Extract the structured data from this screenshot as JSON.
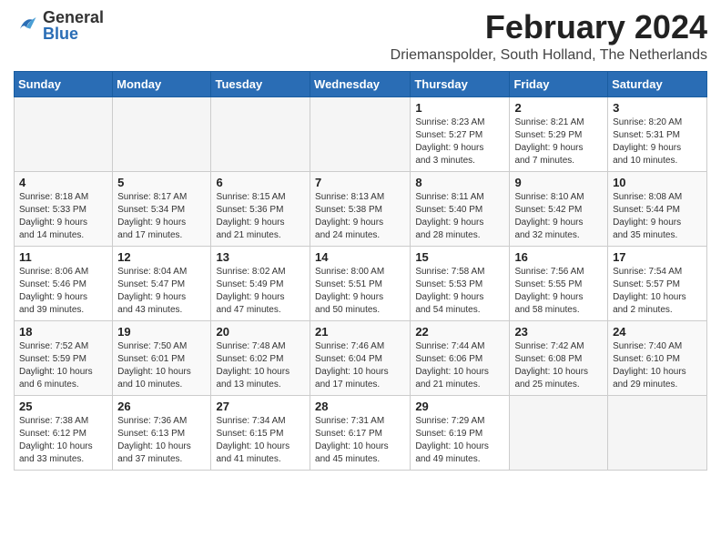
{
  "logo": {
    "general": "General",
    "blue": "Blue"
  },
  "title": "February 2024",
  "location": "Driemanspolder, South Holland, The Netherlands",
  "weekdays": [
    "Sunday",
    "Monday",
    "Tuesday",
    "Wednesday",
    "Thursday",
    "Friday",
    "Saturday"
  ],
  "weeks": [
    [
      {
        "day": "",
        "info": ""
      },
      {
        "day": "",
        "info": ""
      },
      {
        "day": "",
        "info": ""
      },
      {
        "day": "",
        "info": ""
      },
      {
        "day": "1",
        "info": "Sunrise: 8:23 AM\nSunset: 5:27 PM\nDaylight: 9 hours\nand 3 minutes."
      },
      {
        "day": "2",
        "info": "Sunrise: 8:21 AM\nSunset: 5:29 PM\nDaylight: 9 hours\nand 7 minutes."
      },
      {
        "day": "3",
        "info": "Sunrise: 8:20 AM\nSunset: 5:31 PM\nDaylight: 9 hours\nand 10 minutes."
      }
    ],
    [
      {
        "day": "4",
        "info": "Sunrise: 8:18 AM\nSunset: 5:33 PM\nDaylight: 9 hours\nand 14 minutes."
      },
      {
        "day": "5",
        "info": "Sunrise: 8:17 AM\nSunset: 5:34 PM\nDaylight: 9 hours\nand 17 minutes."
      },
      {
        "day": "6",
        "info": "Sunrise: 8:15 AM\nSunset: 5:36 PM\nDaylight: 9 hours\nand 21 minutes."
      },
      {
        "day": "7",
        "info": "Sunrise: 8:13 AM\nSunset: 5:38 PM\nDaylight: 9 hours\nand 24 minutes."
      },
      {
        "day": "8",
        "info": "Sunrise: 8:11 AM\nSunset: 5:40 PM\nDaylight: 9 hours\nand 28 minutes."
      },
      {
        "day": "9",
        "info": "Sunrise: 8:10 AM\nSunset: 5:42 PM\nDaylight: 9 hours\nand 32 minutes."
      },
      {
        "day": "10",
        "info": "Sunrise: 8:08 AM\nSunset: 5:44 PM\nDaylight: 9 hours\nand 35 minutes."
      }
    ],
    [
      {
        "day": "11",
        "info": "Sunrise: 8:06 AM\nSunset: 5:46 PM\nDaylight: 9 hours\nand 39 minutes."
      },
      {
        "day": "12",
        "info": "Sunrise: 8:04 AM\nSunset: 5:47 PM\nDaylight: 9 hours\nand 43 minutes."
      },
      {
        "day": "13",
        "info": "Sunrise: 8:02 AM\nSunset: 5:49 PM\nDaylight: 9 hours\nand 47 minutes."
      },
      {
        "day": "14",
        "info": "Sunrise: 8:00 AM\nSunset: 5:51 PM\nDaylight: 9 hours\nand 50 minutes."
      },
      {
        "day": "15",
        "info": "Sunrise: 7:58 AM\nSunset: 5:53 PM\nDaylight: 9 hours\nand 54 minutes."
      },
      {
        "day": "16",
        "info": "Sunrise: 7:56 AM\nSunset: 5:55 PM\nDaylight: 9 hours\nand 58 minutes."
      },
      {
        "day": "17",
        "info": "Sunrise: 7:54 AM\nSunset: 5:57 PM\nDaylight: 10 hours\nand 2 minutes."
      }
    ],
    [
      {
        "day": "18",
        "info": "Sunrise: 7:52 AM\nSunset: 5:59 PM\nDaylight: 10 hours\nand 6 minutes."
      },
      {
        "day": "19",
        "info": "Sunrise: 7:50 AM\nSunset: 6:01 PM\nDaylight: 10 hours\nand 10 minutes."
      },
      {
        "day": "20",
        "info": "Sunrise: 7:48 AM\nSunset: 6:02 PM\nDaylight: 10 hours\nand 13 minutes."
      },
      {
        "day": "21",
        "info": "Sunrise: 7:46 AM\nSunset: 6:04 PM\nDaylight: 10 hours\nand 17 minutes."
      },
      {
        "day": "22",
        "info": "Sunrise: 7:44 AM\nSunset: 6:06 PM\nDaylight: 10 hours\nand 21 minutes."
      },
      {
        "day": "23",
        "info": "Sunrise: 7:42 AM\nSunset: 6:08 PM\nDaylight: 10 hours\nand 25 minutes."
      },
      {
        "day": "24",
        "info": "Sunrise: 7:40 AM\nSunset: 6:10 PM\nDaylight: 10 hours\nand 29 minutes."
      }
    ],
    [
      {
        "day": "25",
        "info": "Sunrise: 7:38 AM\nSunset: 6:12 PM\nDaylight: 10 hours\nand 33 minutes."
      },
      {
        "day": "26",
        "info": "Sunrise: 7:36 AM\nSunset: 6:13 PM\nDaylight: 10 hours\nand 37 minutes."
      },
      {
        "day": "27",
        "info": "Sunrise: 7:34 AM\nSunset: 6:15 PM\nDaylight: 10 hours\nand 41 minutes."
      },
      {
        "day": "28",
        "info": "Sunrise: 7:31 AM\nSunset: 6:17 PM\nDaylight: 10 hours\nand 45 minutes."
      },
      {
        "day": "29",
        "info": "Sunrise: 7:29 AM\nSunset: 6:19 PM\nDaylight: 10 hours\nand 49 minutes."
      },
      {
        "day": "",
        "info": ""
      },
      {
        "day": "",
        "info": ""
      }
    ]
  ]
}
